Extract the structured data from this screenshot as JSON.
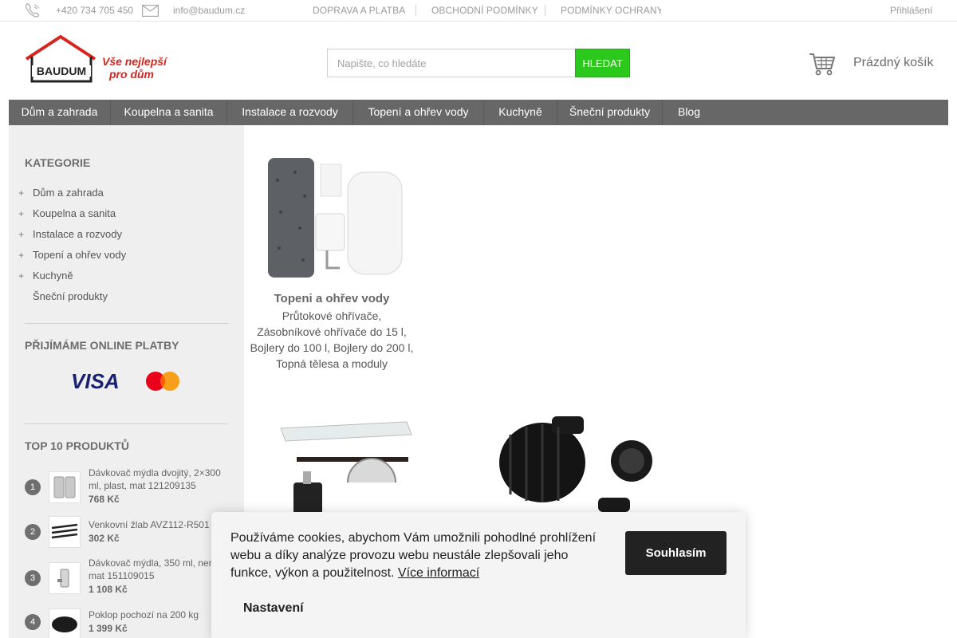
{
  "topbar": {
    "phone": "+420 734 705 450",
    "email": "info@baudum.cz",
    "links": [
      "DOPRAVA A PLATBA",
      "OBCHODNÍ PODMÍNKY",
      "PODMÍNKY OCHRANY O"
    ],
    "login": "Přihlášení"
  },
  "logo": {
    "brand": "BAUDUM",
    "tagline_line1": "Vše nejlepší",
    "tagline_line2": "pro  dům"
  },
  "search": {
    "placeholder": "Napište, co hledáte",
    "button": "HLEDAT"
  },
  "cart": {
    "label": "Prázdný košík"
  },
  "nav": [
    "Dům a zahrada",
    "Koupelna a sanita",
    "Instalace a rozvody",
    "Topení a ohřev vody",
    "Kuchyně",
    "Šneční produkty",
    "Blog"
  ],
  "sidebar": {
    "categories_heading": "KATEGORIE",
    "categories": [
      {
        "label": "Dům a zahrada",
        "expandable": true
      },
      {
        "label": "Koupelna a sanita",
        "expandable": true
      },
      {
        "label": "Instalace a rozvody",
        "expandable": true
      },
      {
        "label": "Topení a ohřev vody",
        "expandable": true
      },
      {
        "label": "Kuchyně",
        "expandable": true
      },
      {
        "label": "Šneční produkty",
        "expandable": false
      }
    ],
    "payments_heading": "PŘIJÍMÁME ONLINE PLATBY",
    "payment_logos": [
      "VISA",
      "mastercard"
    ],
    "top_heading": "TOP 10 PRODUKTŮ",
    "top_products": [
      {
        "rank": "1",
        "name": "Dávkovač mýdla dvojitý, 2×300 ml, plast, mat 121209135",
        "price": "768 Kč"
      },
      {
        "rank": "2",
        "name": "Venkovní žlab AVZ112-R501",
        "price": "302 Kč"
      },
      {
        "rank": "3",
        "name": "Dávkovač mýdla, 350 ml, nerez, mat 151109015",
        "price": "1 108 Kč"
      },
      {
        "rank": "4",
        "name": "Poklop pochozí na 200 kg",
        "price": "1 399 Kč"
      }
    ]
  },
  "main": {
    "cards": [
      {
        "title": "Topeni a ohřev vody",
        "sub": [
          "Průtokové ohřívače,",
          "Zásobníkové ohřívače do 15 l,",
          "Bojlery do 100 l, Bojlery do 200 l,",
          "Topná tělesa a moduly"
        ]
      }
    ]
  },
  "cookie": {
    "text": "Používáme cookies, abychom Vám umožnili pohodlné prohlížení webu a díky analýze provozu webu neustále zlepšovali jeho funkce, výkon a použitelnost.",
    "link": "Více informací",
    "agree": "Souhlasím",
    "settings": "Nastavení"
  },
  "colors": {
    "accent_green": "#2cc91d",
    "nav_bg": "#676767",
    "sidebar_bg": "#efefef",
    "logo_red": "#d6251f"
  }
}
